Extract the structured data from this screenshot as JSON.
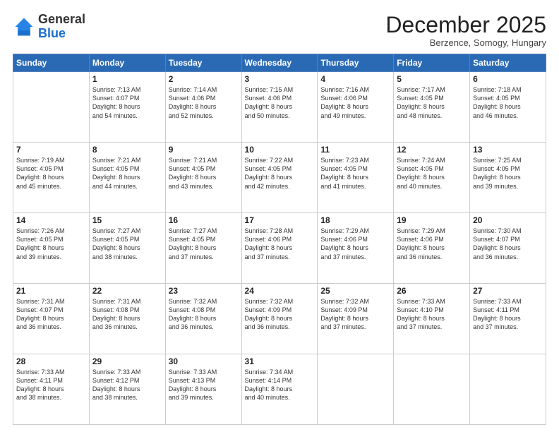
{
  "header": {
    "logo": {
      "general": "General",
      "blue": "Blue"
    },
    "title": "December 2025",
    "subtitle": "Berzence, Somogy, Hungary"
  },
  "weekdays": [
    "Sunday",
    "Monday",
    "Tuesday",
    "Wednesday",
    "Thursday",
    "Friday",
    "Saturday"
  ],
  "weeks": [
    [
      {
        "day": "",
        "info": ""
      },
      {
        "day": "1",
        "info": "Sunrise: 7:13 AM\nSunset: 4:07 PM\nDaylight: 8 hours\nand 54 minutes."
      },
      {
        "day": "2",
        "info": "Sunrise: 7:14 AM\nSunset: 4:06 PM\nDaylight: 8 hours\nand 52 minutes."
      },
      {
        "day": "3",
        "info": "Sunrise: 7:15 AM\nSunset: 4:06 PM\nDaylight: 8 hours\nand 50 minutes."
      },
      {
        "day": "4",
        "info": "Sunrise: 7:16 AM\nSunset: 4:06 PM\nDaylight: 8 hours\nand 49 minutes."
      },
      {
        "day": "5",
        "info": "Sunrise: 7:17 AM\nSunset: 4:05 PM\nDaylight: 8 hours\nand 48 minutes."
      },
      {
        "day": "6",
        "info": "Sunrise: 7:18 AM\nSunset: 4:05 PM\nDaylight: 8 hours\nand 46 minutes."
      }
    ],
    [
      {
        "day": "7",
        "info": "Sunrise: 7:19 AM\nSunset: 4:05 PM\nDaylight: 8 hours\nand 45 minutes."
      },
      {
        "day": "8",
        "info": "Sunrise: 7:21 AM\nSunset: 4:05 PM\nDaylight: 8 hours\nand 44 minutes."
      },
      {
        "day": "9",
        "info": "Sunrise: 7:21 AM\nSunset: 4:05 PM\nDaylight: 8 hours\nand 43 minutes."
      },
      {
        "day": "10",
        "info": "Sunrise: 7:22 AM\nSunset: 4:05 PM\nDaylight: 8 hours\nand 42 minutes."
      },
      {
        "day": "11",
        "info": "Sunrise: 7:23 AM\nSunset: 4:05 PM\nDaylight: 8 hours\nand 41 minutes."
      },
      {
        "day": "12",
        "info": "Sunrise: 7:24 AM\nSunset: 4:05 PM\nDaylight: 8 hours\nand 40 minutes."
      },
      {
        "day": "13",
        "info": "Sunrise: 7:25 AM\nSunset: 4:05 PM\nDaylight: 8 hours\nand 39 minutes."
      }
    ],
    [
      {
        "day": "14",
        "info": "Sunrise: 7:26 AM\nSunset: 4:05 PM\nDaylight: 8 hours\nand 39 minutes."
      },
      {
        "day": "15",
        "info": "Sunrise: 7:27 AM\nSunset: 4:05 PM\nDaylight: 8 hours\nand 38 minutes."
      },
      {
        "day": "16",
        "info": "Sunrise: 7:27 AM\nSunset: 4:05 PM\nDaylight: 8 hours\nand 37 minutes."
      },
      {
        "day": "17",
        "info": "Sunrise: 7:28 AM\nSunset: 4:06 PM\nDaylight: 8 hours\nand 37 minutes."
      },
      {
        "day": "18",
        "info": "Sunrise: 7:29 AM\nSunset: 4:06 PM\nDaylight: 8 hours\nand 37 minutes."
      },
      {
        "day": "19",
        "info": "Sunrise: 7:29 AM\nSunset: 4:06 PM\nDaylight: 8 hours\nand 36 minutes."
      },
      {
        "day": "20",
        "info": "Sunrise: 7:30 AM\nSunset: 4:07 PM\nDaylight: 8 hours\nand 36 minutes."
      }
    ],
    [
      {
        "day": "21",
        "info": "Sunrise: 7:31 AM\nSunset: 4:07 PM\nDaylight: 8 hours\nand 36 minutes."
      },
      {
        "day": "22",
        "info": "Sunrise: 7:31 AM\nSunset: 4:08 PM\nDaylight: 8 hours\nand 36 minutes."
      },
      {
        "day": "23",
        "info": "Sunrise: 7:32 AM\nSunset: 4:08 PM\nDaylight: 8 hours\nand 36 minutes."
      },
      {
        "day": "24",
        "info": "Sunrise: 7:32 AM\nSunset: 4:09 PM\nDaylight: 8 hours\nand 36 minutes."
      },
      {
        "day": "25",
        "info": "Sunrise: 7:32 AM\nSunset: 4:09 PM\nDaylight: 8 hours\nand 37 minutes."
      },
      {
        "day": "26",
        "info": "Sunrise: 7:33 AM\nSunset: 4:10 PM\nDaylight: 8 hours\nand 37 minutes."
      },
      {
        "day": "27",
        "info": "Sunrise: 7:33 AM\nSunset: 4:11 PM\nDaylight: 8 hours\nand 37 minutes."
      }
    ],
    [
      {
        "day": "28",
        "info": "Sunrise: 7:33 AM\nSunset: 4:11 PM\nDaylight: 8 hours\nand 38 minutes."
      },
      {
        "day": "29",
        "info": "Sunrise: 7:33 AM\nSunset: 4:12 PM\nDaylight: 8 hours\nand 38 minutes."
      },
      {
        "day": "30",
        "info": "Sunrise: 7:33 AM\nSunset: 4:13 PM\nDaylight: 8 hours\nand 39 minutes."
      },
      {
        "day": "31",
        "info": "Sunrise: 7:34 AM\nSunset: 4:14 PM\nDaylight: 8 hours\nand 40 minutes."
      },
      {
        "day": "",
        "info": ""
      },
      {
        "day": "",
        "info": ""
      },
      {
        "day": "",
        "info": ""
      }
    ]
  ]
}
